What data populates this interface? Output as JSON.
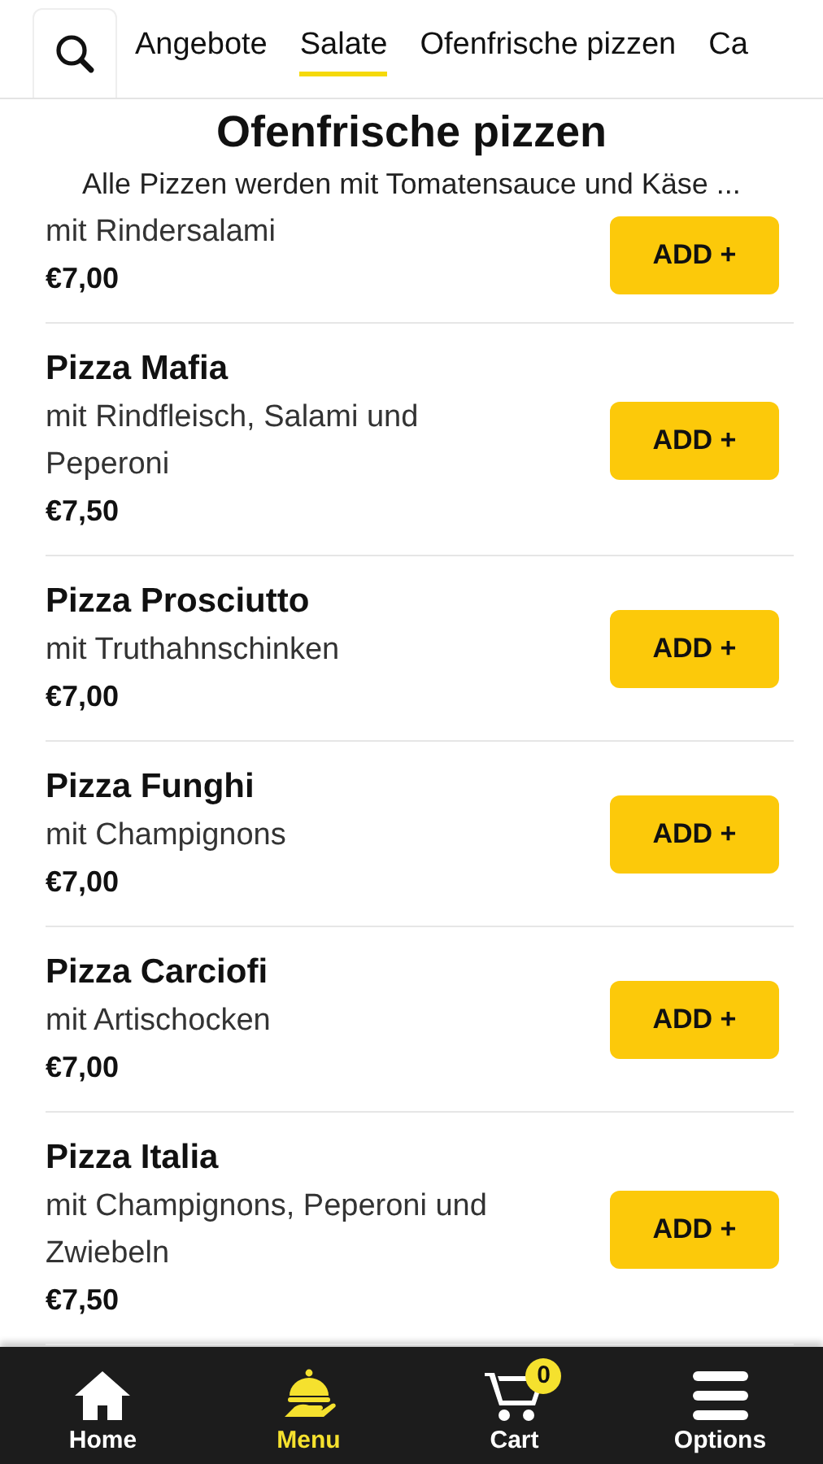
{
  "tabs": [
    {
      "label": "Angebote",
      "selected": false
    },
    {
      "label": "Salate",
      "selected": true
    },
    {
      "label": "Ofenfrische pizzen",
      "selected": false
    },
    {
      "label": "Ca",
      "selected": false
    }
  ],
  "section": {
    "title": "Ofenfrische pizzen",
    "subtitle": "Alle Pizzen werden mit Tomatensauce und Käse ..."
  },
  "items": [
    {
      "description": "mit Rindersalami",
      "price": "€7,00",
      "button": "ADD +"
    },
    {
      "name": "Pizza Mafia",
      "description": "mit Rindfleisch, Salami und Peperoni",
      "price": "€7,50",
      "button": "ADD +"
    },
    {
      "name": "Pizza Prosciutto",
      "description": "mit Truthahnschinken",
      "price": "€7,00",
      "button": "ADD +"
    },
    {
      "name": "Pizza Funghi",
      "description": "mit Champignons",
      "price": "€7,00",
      "button": "ADD +"
    },
    {
      "name": "Pizza Carciofi",
      "description": "mit Artischocken",
      "price": "€7,00",
      "button": "ADD +"
    },
    {
      "name": "Pizza Italia",
      "description": "mit Champignons, Peperoni und Zwiebeln",
      "price": "€7,50",
      "button": "ADD +"
    }
  ],
  "nav": [
    {
      "kind": "home",
      "label": "Home",
      "selected": false
    },
    {
      "kind": "menu",
      "label": "Menu",
      "selected": true
    },
    {
      "kind": "cart",
      "label": "Cart",
      "selected": false,
      "badge": "0"
    },
    {
      "kind": "options",
      "label": "Options",
      "selected": false
    }
  ]
}
